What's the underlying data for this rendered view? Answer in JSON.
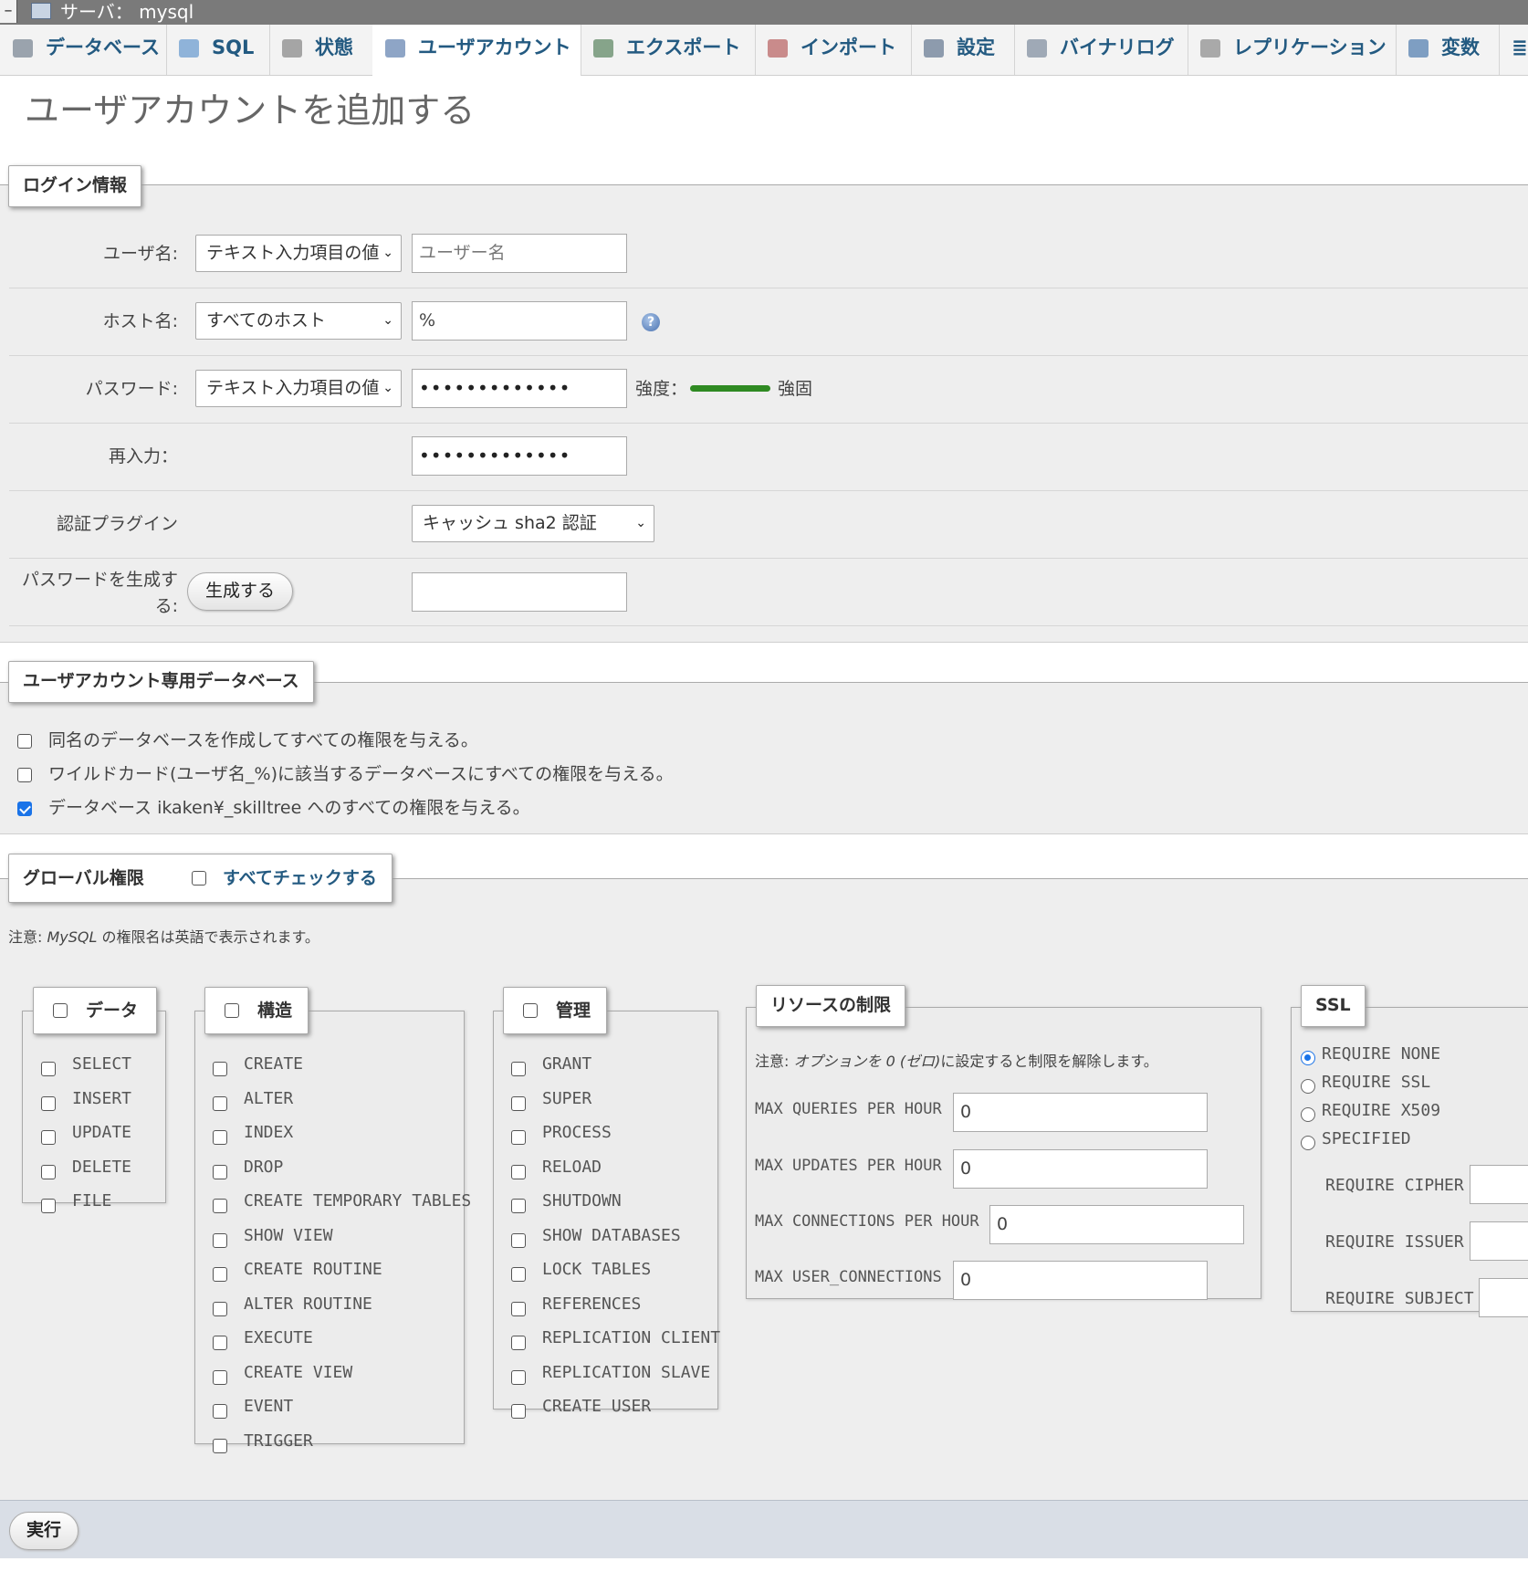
{
  "server": {
    "label": "サーバ： mysql",
    "minus": "–"
  },
  "tabs": [
    {
      "label": "データベース",
      "icon": "database-icon",
      "color": "#9aa3ad"
    },
    {
      "label": "SQL",
      "icon": "sql-icon",
      "color": "#8fb3d9"
    },
    {
      "label": "状態",
      "icon": "status-icon",
      "color": "#a5a5a5"
    },
    {
      "label": "ユーザアカウント",
      "icon": "user-accounts-icon",
      "color": "#8ea5c6"
    },
    {
      "label": "エクスポート",
      "icon": "export-icon",
      "color": "#86a48a"
    },
    {
      "label": "インポート",
      "icon": "import-icon",
      "color": "#c98b8b"
    },
    {
      "label": "設定",
      "icon": "wrench-icon",
      "color": "#8d9bad"
    },
    {
      "label": "バイナリログ",
      "icon": "binlog-icon",
      "color": "#9fa9b6"
    },
    {
      "label": "レプリケーション",
      "icon": "replication-icon",
      "color": "#a9a9a9"
    },
    {
      "label": "変数",
      "icon": "variables-icon",
      "color": "#7e9ec2"
    }
  ],
  "page_title": "ユーザアカウントを追加する",
  "login": {
    "legend": "ログイン情報",
    "username_label": "ユーザ名:",
    "username_select": "テキスト入力項目の値",
    "username_placeholder": "ユーザー名",
    "host_label": "ホスト名:",
    "host_select": "すべてのホスト",
    "host_value": "%",
    "password_label": "パスワード:",
    "password_select": "テキスト入力項目の値",
    "password_value": "•••••••••••••",
    "strength_label": "強度：",
    "strength_value": "強固",
    "strength_level": 1.0,
    "retype_label": "再入力：",
    "retype_value": "•••••••••••••",
    "auth_label": "認証プラグイン",
    "auth_select": "キャッシュ sha2 認証",
    "generate_label_1": "パスワードを生成す",
    "generate_label_2": "る:",
    "generate_button": "生成する",
    "generated_value": ""
  },
  "userdb": {
    "legend": "ユーザアカウント専用データベース",
    "options": [
      {
        "label": "同名のデータベースを作成してすべての権限を与える。",
        "checked": false
      },
      {
        "label": "ワイルドカード(ユーザ名_%)に該当するデータベースにすべての権限を与える。",
        "checked": false
      },
      {
        "label": "データベース ikaken¥_skilltree へのすべての権限を与える。",
        "checked": true
      }
    ]
  },
  "global": {
    "legend": "グローバル権限",
    "check_all": "すべてチェックする",
    "note_prefix": "注意: ",
    "note_mysql": "MySQL",
    "note_rest": " の権限名は英語で表示されます。",
    "data": {
      "legend": "データ",
      "items": [
        "SELECT",
        "INSERT",
        "UPDATE",
        "DELETE",
        "FILE"
      ]
    },
    "structure": {
      "legend": "構造",
      "items": [
        "CREATE",
        "ALTER",
        "INDEX",
        "DROP",
        "CREATE TEMPORARY TABLES",
        "SHOW VIEW",
        "CREATE ROUTINE",
        "ALTER ROUTINE",
        "EXECUTE",
        "CREATE VIEW",
        "EVENT",
        "TRIGGER"
      ]
    },
    "admin": {
      "legend": "管理",
      "items": [
        "GRANT",
        "SUPER",
        "PROCESS",
        "RELOAD",
        "SHUTDOWN",
        "SHOW DATABASES",
        "LOCK TABLES",
        "REFERENCES",
        "REPLICATION CLIENT",
        "REPLICATION SLAVE",
        "CREATE USER"
      ]
    },
    "resources": {
      "legend": "リソースの制限",
      "note_prefix": "注意: ",
      "note_a": "オプションを ",
      "note_zero": "0",
      "note_b": " (ゼロ)",
      "note_c": "に設定すると制限を解除します。",
      "limits": [
        {
          "label": "MAX QUERIES PER HOUR",
          "value": "0"
        },
        {
          "label": "MAX UPDATES PER HOUR",
          "value": "0"
        },
        {
          "label": "MAX CONNECTIONS PER HOUR",
          "value": "0"
        },
        {
          "label": "MAX USER_CONNECTIONS",
          "value": "0"
        }
      ]
    },
    "ssl": {
      "legend": "SSL",
      "options": [
        {
          "label": "REQUIRE NONE",
          "selected": true
        },
        {
          "label": "REQUIRE SSL",
          "selected": false
        },
        {
          "label": "REQUIRE X509",
          "selected": false
        },
        {
          "label": "SPECIFIED",
          "selected": false
        }
      ],
      "fields": [
        "REQUIRE CIPHER",
        "REQUIRE ISSUER",
        "REQUIRE SUBJECT"
      ]
    }
  },
  "footer": {
    "submit": "実行"
  }
}
